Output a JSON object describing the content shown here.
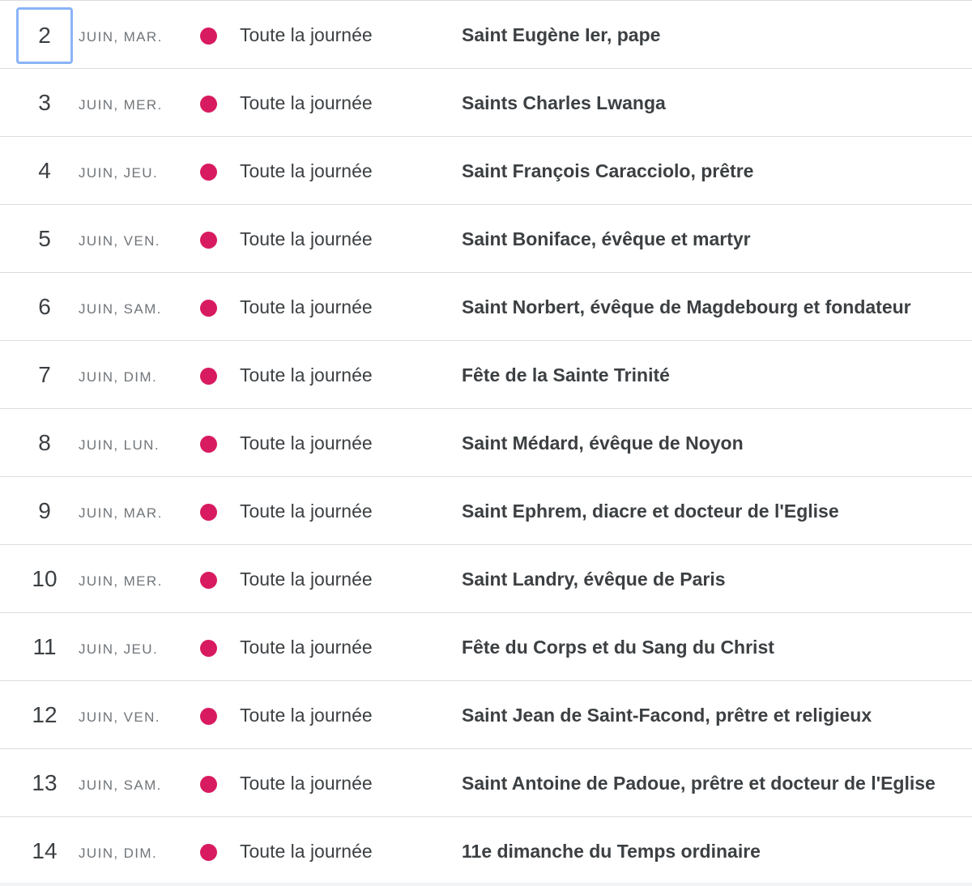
{
  "colors": {
    "event_dot": "#d81b60",
    "focus_ring": "#8ab4f8",
    "divider": "#dadce0",
    "text_primary": "#3c4043",
    "text_secondary": "#70757a"
  },
  "events": [
    {
      "day": "2",
      "date_label": "JUIN, MAR.",
      "time": "Toute la journée",
      "title": "Saint Eugène Ier, pape"
    },
    {
      "day": "3",
      "date_label": "JUIN, MER.",
      "time": "Toute la journée",
      "title": "Saints Charles Lwanga"
    },
    {
      "day": "4",
      "date_label": "JUIN, JEU.",
      "time": "Toute la journée",
      "title": "Saint François Caracciolo, prêtre"
    },
    {
      "day": "5",
      "date_label": "JUIN, VEN.",
      "time": "Toute la journée",
      "title": "Saint Boniface, évêque et martyr"
    },
    {
      "day": "6",
      "date_label": "JUIN, SAM.",
      "time": "Toute la journée",
      "title": "Saint Norbert, évêque de Magdebourg et fondateur"
    },
    {
      "day": "7",
      "date_label": "JUIN, DIM.",
      "time": "Toute la journée",
      "title": "Fête de la Sainte Trinité"
    },
    {
      "day": "8",
      "date_label": "JUIN, LUN.",
      "time": "Toute la journée",
      "title": "Saint Médard, évêque de Noyon"
    },
    {
      "day": "9",
      "date_label": "JUIN, MAR.",
      "time": "Toute la journée",
      "title": "Saint Ephrem, diacre et docteur de l'Eglise"
    },
    {
      "day": "10",
      "date_label": "JUIN, MER.",
      "time": "Toute la journée",
      "title": "Saint Landry, évêque de Paris"
    },
    {
      "day": "11",
      "date_label": "JUIN, JEU.",
      "time": "Toute la journée",
      "title": "Fête du Corps et du Sang du Christ"
    },
    {
      "day": "12",
      "date_label": "JUIN, VEN.",
      "time": "Toute la journée",
      "title": "Saint Jean de Saint-Facond, prêtre et religieux"
    },
    {
      "day": "13",
      "date_label": "JUIN, SAM.",
      "time": "Toute la journée",
      "title": "Saint Antoine de Padoue, prêtre et docteur de l'Eglise"
    },
    {
      "day": "14",
      "date_label": "JUIN, DIM.",
      "time": "Toute la journée",
      "title": "11e dimanche du Temps ordinaire"
    }
  ]
}
